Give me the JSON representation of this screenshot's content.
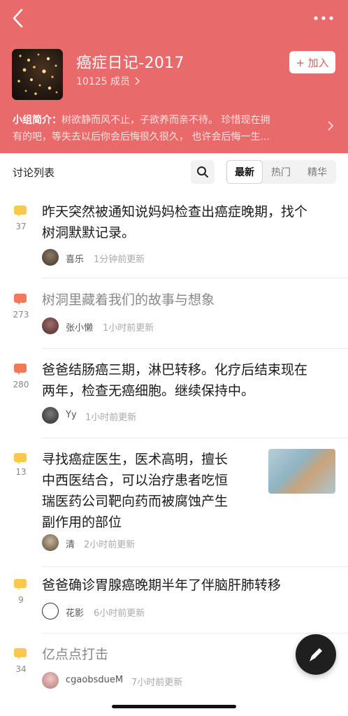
{
  "header": {
    "back_icon": "chevron-left-icon",
    "more_icon": "more-horizontal-icon",
    "group_name": "癌症日记-2017",
    "member_count": "10125 成员",
    "join_label": "+ 加入",
    "intro_label": "小组简介：",
    "intro_line1": "树欲静而风不止，子欲养而亲不待。 珍惜现在拥",
    "intro_line2": "有的吧，等失去以后你会后悔很久很久，  也许会后悔一生...",
    "background_color": "#e86a6a"
  },
  "toolbar": {
    "list_title": "讨论列表",
    "search_icon": "search-icon",
    "tabs": [
      {
        "label": "最新",
        "active": true
      },
      {
        "label": "热门",
        "active": false
      },
      {
        "label": "精华",
        "active": false
      }
    ]
  },
  "posts": [
    {
      "count": "37",
      "title_lines": [
        "昨天突然被通知说妈妈检查出癌症晚期，找个",
        "树洞默默记录。"
      ],
      "author": "喜乐",
      "time": "1分钟前更新",
      "icon_color": "yellow",
      "read": false
    },
    {
      "count": "273",
      "title_lines": [
        "树洞里藏着我们的故事与想象"
      ],
      "author": "张小懒",
      "time": "1小时前更新",
      "icon_color": "orange",
      "read": true
    },
    {
      "count": "280",
      "title_lines": [
        "爸爸结肠癌三期，淋巴转移。化疗后结束现在",
        "两年，检查无癌细胞。继续保持中。"
      ],
      "author": "Yy",
      "time": "1小时前更新",
      "icon_color": "orange",
      "read": false
    },
    {
      "count": "13",
      "title_lines": [
        "寻找癌症医生，医术高明，擅长",
        "中西医结合，可以治疗患者吃恒",
        "瑞医药公司靶向药而被腐蚀产生",
        "副作用的部位"
      ],
      "author": "清",
      "time": "2小时前更新",
      "icon_color": "yellow",
      "read": false,
      "has_thumbnail": true
    },
    {
      "count": "9",
      "title_lines": [
        "爸爸确诊胃腺癌晚期半年了伴脑肝肺转移"
      ],
      "author": "花影",
      "time": "6小时前更新",
      "icon_color": "yellow",
      "read": false
    },
    {
      "count": "34",
      "title_lines": [
        "亿点点打击"
      ],
      "author": "cgaobsdueM",
      "time": "7小时前更新",
      "icon_color": "yellow",
      "read": true
    }
  ],
  "fab_icon": "pencil-icon"
}
